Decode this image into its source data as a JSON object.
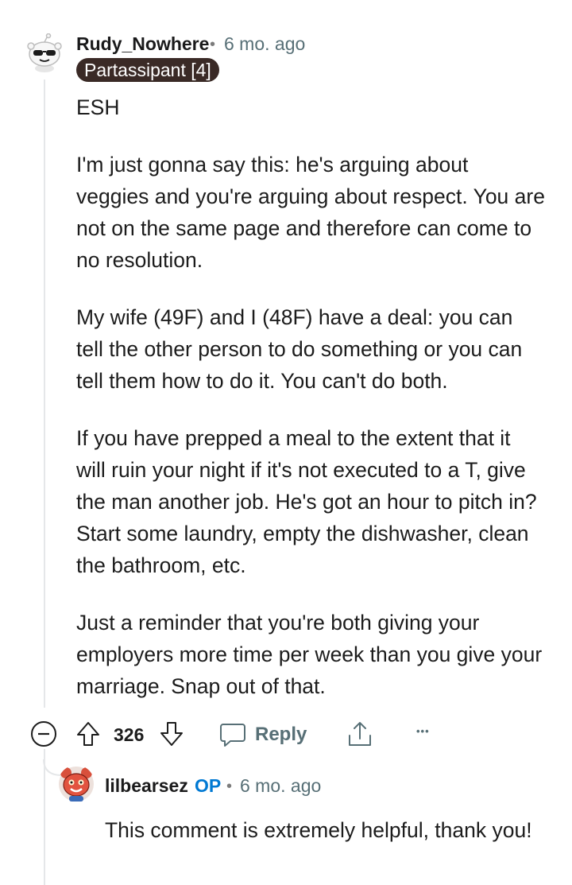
{
  "comment": {
    "username": "Rudy_Nowhere",
    "separator": "•",
    "time": "6 mo. ago",
    "flair": "Partassipant [4]",
    "paragraphs": [
      "ESH",
      "I'm just gonna say this: he's arguing about veggies and you're arguing about respect. You are not on the same page and therefore can come to no resolution.",
      "My wife (49F) and I (48F) have a deal: you can tell the other person to do something or you can tell them how to do it. You can't do both.",
      "If you have prepped a meal to the extent that it will ruin your night if it's not executed to a T, give the man another job. He's got an hour to pitch in? Start some laundry, empty the dishwasher, clean the bathroom, etc.",
      "Just a reminder that you're both giving your employers more time per week than you give your marriage. Snap out of that."
    ],
    "score": "326",
    "reply_label": "Reply",
    "more_label": "•••"
  },
  "reply": {
    "username": "lilbearsez",
    "op_badge": "OP",
    "separator": "•",
    "time": "6 mo. ago",
    "text": "This comment is extremely helpful, thank you!"
  },
  "icons": [
    "snoo-sunglasses-avatar",
    "collapse-icon",
    "upvote-icon",
    "downvote-icon",
    "reply-bubble-icon",
    "share-icon",
    "more-icon",
    "snoo-bear-avatar"
  ],
  "colors": {
    "accent_op": "#0079d3",
    "flair_bg": "#3a2a26",
    "meta_gray": "#576f76"
  }
}
